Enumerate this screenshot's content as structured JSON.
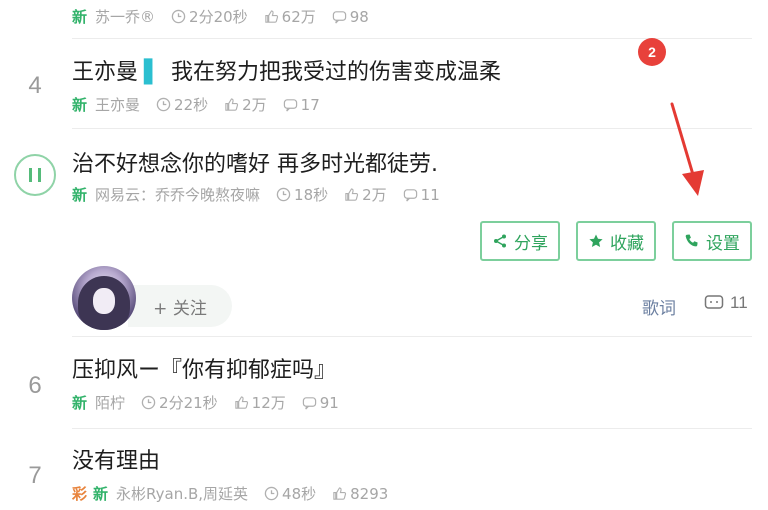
{
  "rows": [
    {
      "rank": "",
      "title": "",
      "tag": "新",
      "artist": "苏一乔®",
      "duration": "2分20秒",
      "likes": "62万",
      "comments": "98"
    },
    {
      "rank": "4",
      "title_artist": "王亦曼",
      "title_mark": "▌",
      "title": "我在努力把我受过的伤害变成温柔",
      "tag": "新",
      "artist": "王亦曼",
      "duration": "22秒",
      "likes": "2万",
      "comments": "17"
    },
    {
      "rank": "",
      "title": "治不好想念你的嗜好 再多时光都徒劳.",
      "tag": "新",
      "artist": "网易云：乔乔今晚熬夜嘛",
      "duration": "18秒",
      "likes": "2万",
      "comments": "11"
    },
    {
      "rank": "6",
      "title": "压抑风ー『你有抑郁症吗』",
      "tag": "新",
      "artist": "陌柠",
      "duration": "2分21秒",
      "likes": "12万",
      "comments": "91"
    },
    {
      "rank": "7",
      "title": "没有理由",
      "tag_color": "彩",
      "tag": "新",
      "artist": "永彬Ryan.B,周延英",
      "duration": "48秒",
      "likes": "8293"
    }
  ],
  "actions": {
    "share": "分享",
    "favorite": "收藏",
    "settings": "设置"
  },
  "user_bar": {
    "follow": "+ 关注",
    "lyrics": "歌词",
    "comment_count": "11"
  },
  "badge": "2",
  "colors": {
    "accent_green": "#2fa45d",
    "badge_red": "#e8413b",
    "arrow_red": "#e43a33"
  },
  "icons": [
    "clock-icon",
    "like-icon",
    "comment-icon",
    "pause-icon",
    "share-icon",
    "star-icon",
    "phone-icon"
  ]
}
